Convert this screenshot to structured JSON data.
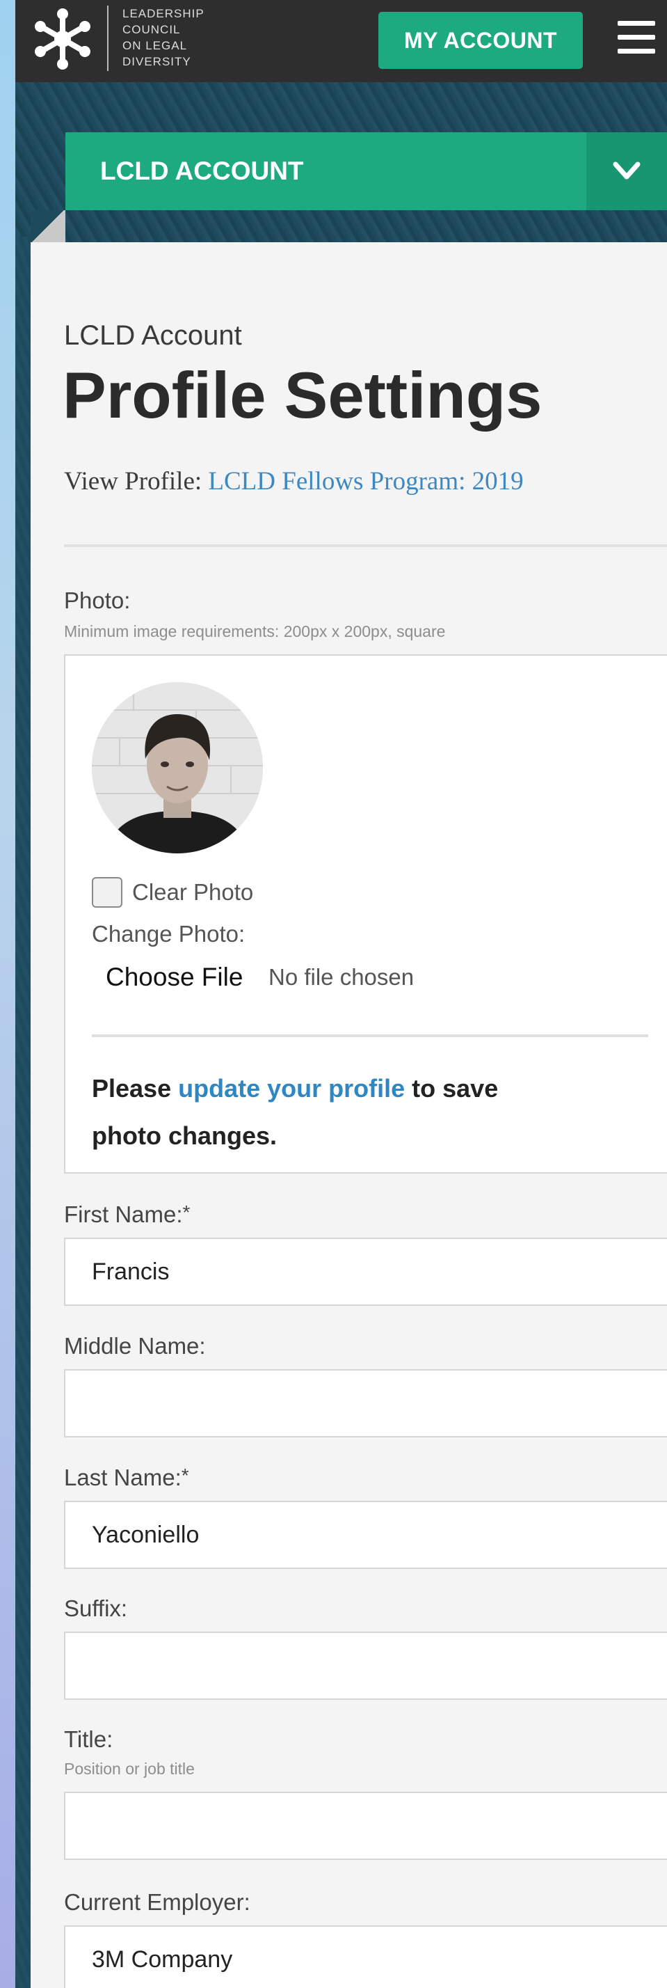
{
  "header": {
    "logo_lines": [
      "LEADERSHIP",
      "COUNCIL",
      "ON LEGAL",
      "DIVERSITY"
    ],
    "my_account_label": "MY ACCOUNT"
  },
  "account_bar": {
    "title": "LCLD ACCOUNT"
  },
  "page": {
    "breadcrumb": "LCLD Account",
    "title": "Profile Settings",
    "view_profile_prefix": "View Profile:",
    "view_profile_link": "LCLD Fellows Program: 2019"
  },
  "photo": {
    "label": "Photo:",
    "hint": "Minimum image requirements: 200px x 200px, square",
    "clear_label": "Clear Photo",
    "change_label": "Change Photo:",
    "choose_file_label": "Choose File",
    "no_file_text": "No file chosen",
    "notice_before": "Please ",
    "notice_link": "update your profile",
    "notice_after": " to save photo changes."
  },
  "fields": {
    "first_name": {
      "label": "First Name:",
      "required_mark": "*",
      "value": "Francis"
    },
    "middle_name": {
      "label": "Middle Name:",
      "value": ""
    },
    "last_name": {
      "label": "Last Name:",
      "required_mark": "*",
      "value": "Yaconiello"
    },
    "suffix": {
      "label": "Suffix:",
      "value": ""
    },
    "title": {
      "label": "Title:",
      "hint": "Position or job title",
      "value": ""
    },
    "employer": {
      "label": "Current Employer:",
      "value": "3M Company"
    }
  },
  "colors": {
    "accent_green": "#1daa80",
    "link_blue": "#3e88c2",
    "header_dark": "#2e2e2e"
  }
}
